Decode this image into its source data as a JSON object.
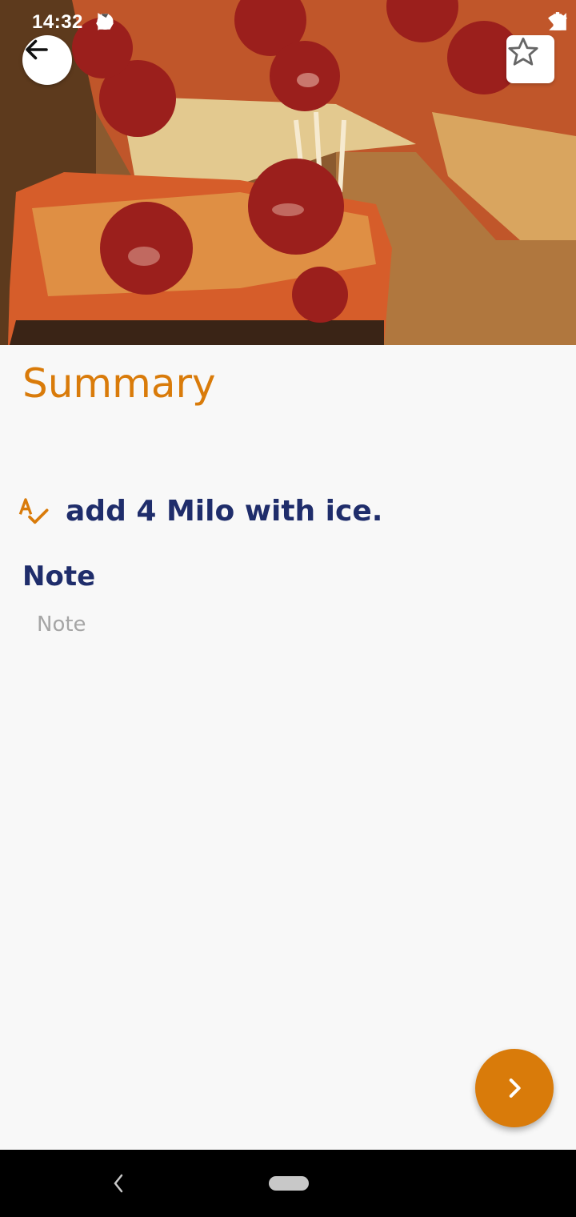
{
  "status_bar": {
    "time": "14:32",
    "left_icons": [
      "sync-icon",
      "drive-icon",
      "play-store-icon"
    ],
    "right_icons": [
      "wifi-icon",
      "signal-icon",
      "battery-icon"
    ]
  },
  "hero": {
    "image": "pepperoni-pizza-photo"
  },
  "header": {
    "back_icon": "arrow-left-icon",
    "favorite_icon": "star-outline-icon"
  },
  "page": {
    "title": "Summary"
  },
  "summary": {
    "icon": "spellcheck-icon",
    "text": "add 4 Milo with ice."
  },
  "note": {
    "heading": "Note",
    "value": "",
    "placeholder": "Note"
  },
  "fab": {
    "icon": "chevron-right-icon"
  },
  "nav": {
    "back_icon": "nav-back-icon",
    "home_icon": "nav-home-pill"
  },
  "colors": {
    "accent": "#d97b0a",
    "heading": "#1f2d6b",
    "background": "#f8f8f8"
  }
}
